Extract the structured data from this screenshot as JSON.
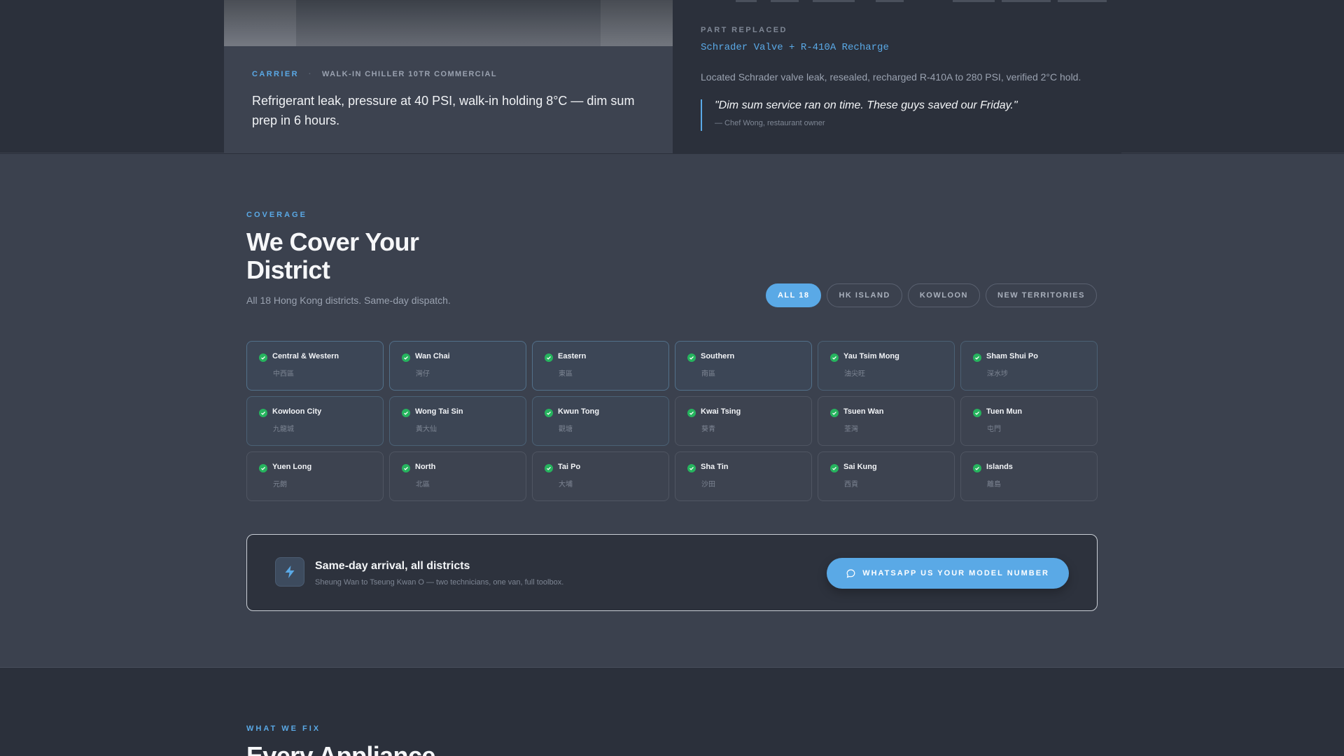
{
  "case_study": {
    "brand": "CARRIER",
    "model": "WALK-IN CHILLER 10TR COMMERCIAL",
    "problem": "Refrigerant leak, pressure at 40 PSI, walk-in holding 8°C — dim sum prep in 6 hours.",
    "part_label": "PART REPLACED",
    "part_name": "Schrader Valve + R-410A Recharge",
    "part_desc": "Located Schrader valve leak, resealed, recharged R-410A to 280 PSI, verified 2°C hold.",
    "quote": "\"Dim sum service ran on time. These guys saved our Friday.\"",
    "quote_by": "— Chef Wong, restaurant owner"
  },
  "coverage": {
    "eyebrow": "COVERAGE",
    "title": "We Cover Your District",
    "subtitle": "All 18 Hong Kong districts. Same-day dispatch.",
    "filters": [
      {
        "label": "ALL 18",
        "active": true
      },
      {
        "label": "HK ISLAND",
        "active": false
      },
      {
        "label": "KOWLOON",
        "active": false
      },
      {
        "label": "NEW TERRITORIES",
        "active": false
      }
    ],
    "districts": [
      {
        "en": "Central & Western",
        "zh": "中西區"
      },
      {
        "en": "Wan Chai",
        "zh": "灣仔"
      },
      {
        "en": "Eastern",
        "zh": "東區"
      },
      {
        "en": "Southern",
        "zh": "南區"
      },
      {
        "en": "Yau Tsim Mong",
        "zh": "油尖旺"
      },
      {
        "en": "Sham Shui Po",
        "zh": "深水埗"
      },
      {
        "en": "Kowloon City",
        "zh": "九龍城"
      },
      {
        "en": "Wong Tai Sin",
        "zh": "黃大仙"
      },
      {
        "en": "Kwun Tong",
        "zh": "觀塘"
      },
      {
        "en": "Kwai Tsing",
        "zh": "葵青"
      },
      {
        "en": "Tsuen Wan",
        "zh": "荃灣"
      },
      {
        "en": "Tuen Mun",
        "zh": "屯門"
      },
      {
        "en": "Yuen Long",
        "zh": "元朗"
      },
      {
        "en": "North",
        "zh": "北區"
      },
      {
        "en": "Tai Po",
        "zh": "大埔"
      },
      {
        "en": "Sha Tin",
        "zh": "沙田"
      },
      {
        "en": "Sai Kung",
        "zh": "西貢"
      },
      {
        "en": "Islands",
        "zh": "離島"
      }
    ],
    "dispatch": {
      "title": "Same-day arrival, all districts",
      "subtitle": "Sheung Wan to Tseung Kwan O — two technicians, one van, full toolbox.",
      "cta": "WHATSAPP US YOUR MODEL NUMBER"
    }
  },
  "fix": {
    "eyebrow": "WHAT WE FIX",
    "title": "Every Appliance"
  },
  "colors": {
    "accent": "#5aa9e6",
    "check": "#26b45e",
    "bg_dark": "#2b303b",
    "bg_section": "#3b414e"
  },
  "icons": {
    "check": "check-circle-icon",
    "bolt": "lightning-bolt-icon",
    "whatsapp": "chat-bubble-icon"
  }
}
